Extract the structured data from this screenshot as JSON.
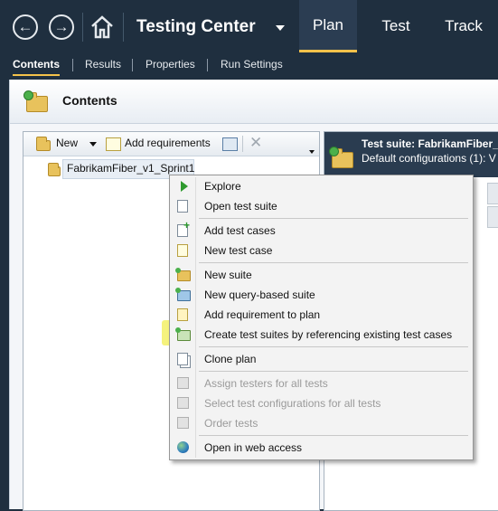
{
  "nav": {
    "back_icon": "back-arrow-icon",
    "forward_icon": "forward-arrow-icon",
    "home_icon": "home-icon",
    "title": "Testing Center",
    "tabs": [
      {
        "label": "Plan",
        "active": true
      },
      {
        "label": "Test",
        "active": false
      },
      {
        "label": "Track",
        "active": false
      }
    ],
    "accent": "#f4c24a"
  },
  "subnav": {
    "items": [
      "Contents",
      "Results",
      "Properties",
      "Run Settings"
    ]
  },
  "contents": {
    "title": "Contents"
  },
  "toolbar": {
    "new_label": "New",
    "add_requirements_label": "Add requirements"
  },
  "tree": {
    "root": "FabrikamFiber_v1_Sprint1"
  },
  "suite": {
    "title": "Test suite:  FabrikamFiber_v",
    "subtitle": "Default configurations (1):  V"
  },
  "menu": {
    "items": [
      {
        "label": "Explore",
        "icon": "play-icon",
        "enabled": true
      },
      {
        "label": "Open test suite",
        "icon": "open-suite-icon",
        "enabled": true
      },
      {
        "label": "Add test cases",
        "icon": "add-test-case-icon",
        "enabled": true
      },
      {
        "label": "New test case",
        "icon": "new-test-case-icon",
        "enabled": true
      },
      {
        "label": "New suite",
        "icon": "suite-icon",
        "enabled": true
      },
      {
        "label": "New query-based suite",
        "icon": "query-suite-icon",
        "enabled": true
      },
      {
        "label": "Add requirement to plan",
        "icon": "requirement-icon",
        "enabled": true
      },
      {
        "label": "Create test suites by referencing existing test cases",
        "icon": "reference-suite-icon",
        "enabled": true,
        "highlighted": true
      },
      {
        "label": "Clone plan",
        "icon": "clone-icon",
        "enabled": true
      },
      {
        "label": "Assign testers for all tests",
        "icon": "assign-testers-icon",
        "enabled": false
      },
      {
        "label": "Select test configurations for all tests",
        "icon": "configurations-icon",
        "enabled": false
      },
      {
        "label": "Order tests",
        "icon": "order-tests-icon",
        "enabled": false
      },
      {
        "label": "Open in web access",
        "icon": "globe-icon",
        "enabled": true
      }
    ],
    "highlight_color": "#f3f066"
  }
}
